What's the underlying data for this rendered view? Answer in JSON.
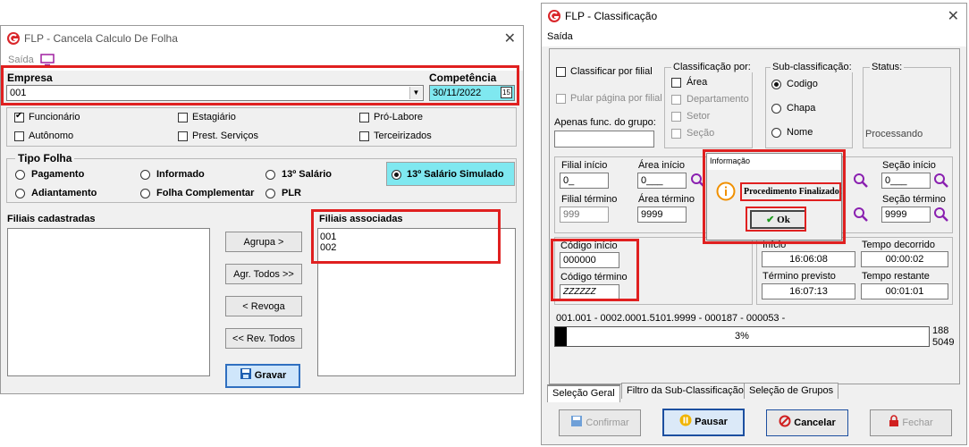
{
  "left_window": {
    "title": "FLP - Cancela Calculo De Folha",
    "menu": {
      "saida": "Saída"
    },
    "empresa": {
      "label": "Empresa",
      "value": "001"
    },
    "competencia": {
      "label": "Competência",
      "value": "30/11/2022",
      "calendar_icon": "15"
    },
    "types": [
      {
        "label": "Funcionário",
        "checked": true
      },
      {
        "label": "Estagiário",
        "checked": false
      },
      {
        "label": "Pró-Labore",
        "checked": false
      },
      {
        "label": "Autônomo",
        "checked": false
      },
      {
        "label": "Prest. Serviços",
        "checked": false
      },
      {
        "label": "Terceirizados",
        "checked": false
      }
    ],
    "tipo_folha": {
      "label": "Tipo Folha",
      "options": [
        "Pagamento",
        "Informado",
        "13º Salário",
        "Adiantamento",
        "Folha Complementar",
        "PLR"
      ],
      "selected": "13º Salário Simulado"
    },
    "filiais_cadastradas": {
      "label": "Filiais cadastradas",
      "items": []
    },
    "filiais_associadas": {
      "label": "Filiais associadas",
      "items": [
        "001",
        "002"
      ]
    },
    "buttons": {
      "agrupa": "Agrupa >",
      "agr_todos": "Agr. Todos >>",
      "revoga": "< Revoga",
      "rev_todos": "<< Rev. Todos",
      "gravar": "Gravar"
    }
  },
  "right_window": {
    "title": "FLP - Classificação",
    "menu": {
      "saida": "Saída"
    },
    "classificar_por_filial": "Classificar por filial",
    "pular_pagina": "Pular página por filial",
    "apenas_grupo": "Apenas func. do grupo:",
    "classificacao": {
      "label": "Classificação  por:",
      "options": [
        "Área",
        "Departamento",
        "Setor",
        "Seção"
      ]
    },
    "subclassificacao": {
      "label": "Sub-classificação:",
      "options": [
        "Codigo",
        "Chapa",
        "Nome"
      ],
      "selected": "Codigo"
    },
    "status": {
      "label": "Status:",
      "value": "Processando"
    },
    "filial": {
      "inicio_label": "Filial início",
      "inicio": "0_",
      "termino_label": "Filial término",
      "termino": "999"
    },
    "area": {
      "inicio_label": "Área início",
      "inicio": "0___",
      "termino_label": "Área término",
      "termino": "9999"
    },
    "secao": {
      "inicio_label": "Seção início",
      "inicio": "0___",
      "termino_label": "Seção término",
      "termino": "9999"
    },
    "codigo": {
      "inicio_label": "Código início",
      "inicio": "000000",
      "termino_label": "Código término",
      "termino": "ZZZZZZ"
    },
    "tempos": {
      "inicio_label": "Início",
      "inicio": "16:06:08",
      "decorrido_label": "Tempo decorrido",
      "decorrido": "00:00:02",
      "termino_label": "Término previsto",
      "termino": "16:07:13",
      "restante_label": "Tempo restante",
      "restante": "00:01:01"
    },
    "progress": {
      "path": "001.001 - 0002.0001.5101.9999 - 000187 - 000053 -",
      "percent_text": "3%",
      "fraction": 0.03,
      "count_done": "188",
      "count_total": "5049"
    },
    "tabs": [
      "Seleção Geral",
      "Filtro da Sub-Classificação",
      "Seleção de Grupos"
    ],
    "buttons": {
      "confirmar": "Confirmar",
      "pausar": "Pausar",
      "cancelar": "Cancelar",
      "fechar": "Fechar"
    },
    "dialog": {
      "title": "Informação",
      "message": "Procedimento Finalizado!",
      "ok": "Ok"
    }
  }
}
